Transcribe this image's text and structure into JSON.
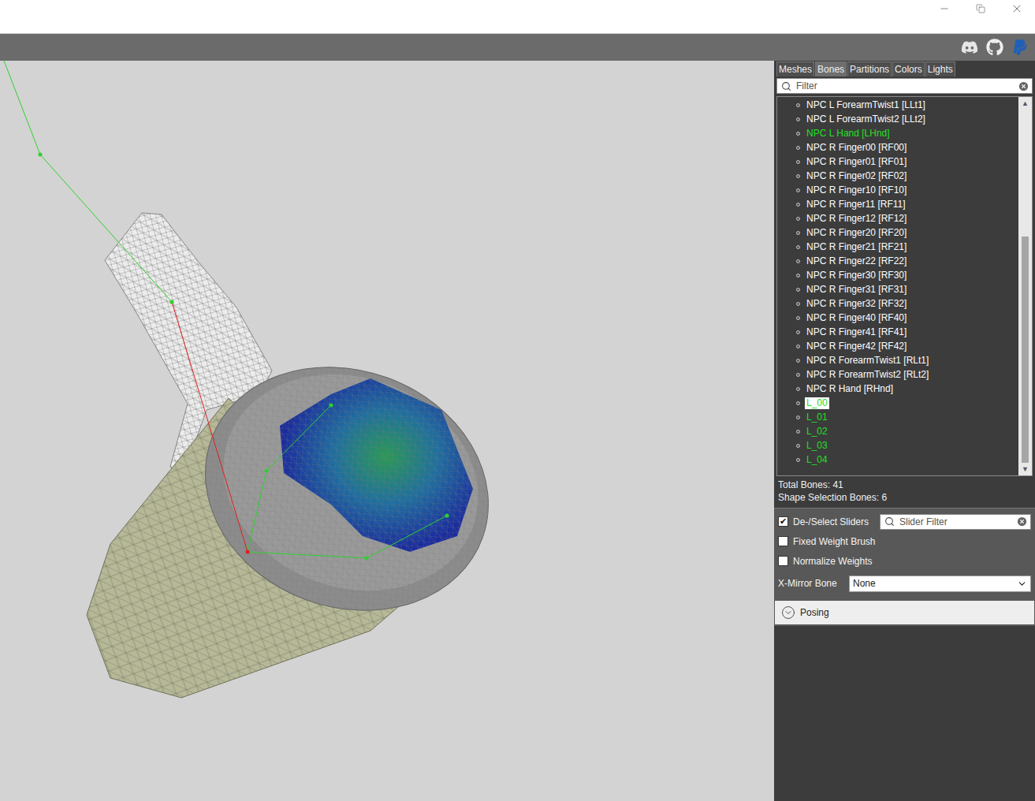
{
  "tabs": [
    {
      "label": "Meshes",
      "selected": false
    },
    {
      "label": "Bones",
      "selected": true
    },
    {
      "label": "Partitions",
      "selected": false
    },
    {
      "label": "Colors",
      "selected": false
    },
    {
      "label": "Lights",
      "selected": false
    }
  ],
  "bone_filter": {
    "placeholder": "Filter"
  },
  "bones": [
    {
      "name": "NPC L ForearmTwist1 [LLt1]",
      "color": "#ffffff",
      "selected": false
    },
    {
      "name": "NPC L ForearmTwist2 [LLt2]",
      "color": "#ffffff",
      "selected": false
    },
    {
      "name": "NPC L Hand [LHnd]",
      "color": "#22e022",
      "selected": false
    },
    {
      "name": "NPC R Finger00 [RF00]",
      "color": "#ffffff",
      "selected": false
    },
    {
      "name": "NPC R Finger01 [RF01]",
      "color": "#ffffff",
      "selected": false
    },
    {
      "name": "NPC R Finger02 [RF02]",
      "color": "#ffffff",
      "selected": false
    },
    {
      "name": "NPC R Finger10 [RF10]",
      "color": "#ffffff",
      "selected": false
    },
    {
      "name": "NPC R Finger11 [RF11]",
      "color": "#ffffff",
      "selected": false
    },
    {
      "name": "NPC R Finger12 [RF12]",
      "color": "#ffffff",
      "selected": false
    },
    {
      "name": "NPC R Finger20 [RF20]",
      "color": "#ffffff",
      "selected": false
    },
    {
      "name": "NPC R Finger21 [RF21]",
      "color": "#ffffff",
      "selected": false
    },
    {
      "name": "NPC R Finger22 [RF22]",
      "color": "#ffffff",
      "selected": false
    },
    {
      "name": "NPC R Finger30 [RF30]",
      "color": "#ffffff",
      "selected": false
    },
    {
      "name": "NPC R Finger31 [RF31]",
      "color": "#ffffff",
      "selected": false
    },
    {
      "name": "NPC R Finger32 [RF32]",
      "color": "#ffffff",
      "selected": false
    },
    {
      "name": "NPC R Finger40 [RF40]",
      "color": "#ffffff",
      "selected": false
    },
    {
      "name": "NPC R Finger41 [RF41]",
      "color": "#ffffff",
      "selected": false
    },
    {
      "name": "NPC R Finger42 [RF42]",
      "color": "#ffffff",
      "selected": false
    },
    {
      "name": "NPC R ForearmTwist1 [RLt1]",
      "color": "#ffffff",
      "selected": false
    },
    {
      "name": "NPC R ForearmTwist2 [RLt2]",
      "color": "#ffffff",
      "selected": false
    },
    {
      "name": "NPC R Hand [RHnd]",
      "color": "#ffffff",
      "selected": false
    },
    {
      "name": "L_00",
      "color": "#22e022",
      "selected": true
    },
    {
      "name": "L_01",
      "color": "#22e022",
      "selected": false
    },
    {
      "name": "L_02",
      "color": "#22e022",
      "selected": false
    },
    {
      "name": "L_03",
      "color": "#22e022",
      "selected": false
    },
    {
      "name": "L_04",
      "color": "#22e022",
      "selected": false
    }
  ],
  "scrollbar": {
    "thumb_start": 0.36,
    "thumb_size": 0.64
  },
  "summary": [
    "Total Bones: 41",
    "Shape Selection Bones: 6"
  ],
  "slider_filter": {
    "placeholder": "Slider Filter"
  },
  "options": [
    {
      "label": "De-/Select Sliders",
      "checked": true
    },
    {
      "label": "Fixed Weight Brush",
      "checked": false
    },
    {
      "label": "Normalize Weights",
      "checked": false
    }
  ],
  "x_mirror": {
    "label": "X-Mirror Bone",
    "value": "None"
  },
  "posing": {
    "label": "Posing",
    "expanded": false
  }
}
